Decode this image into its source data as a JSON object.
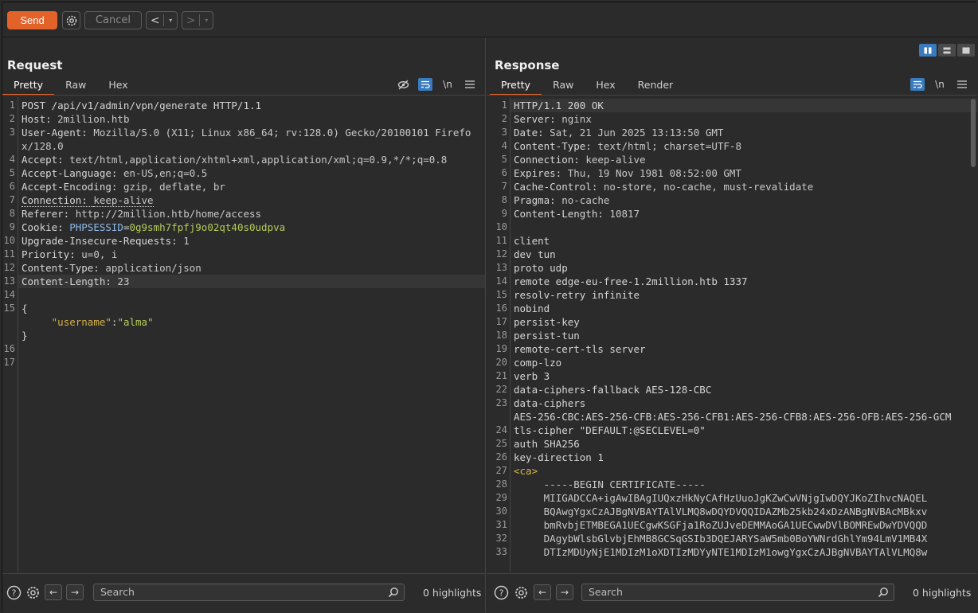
{
  "toolbar": {
    "send_label": "Send",
    "cancel_label": "Cancel",
    "back_glyph": "<",
    "forward_glyph": ">",
    "dropdown_glyph": "▾"
  },
  "request": {
    "title": "Request",
    "tabs": [
      "Pretty",
      "Raw",
      "Hex"
    ],
    "active_tab": "Pretty",
    "tools": [
      "eye-slash-icon",
      "wrap-icon",
      "newline-icon",
      "menu-icon"
    ],
    "newline_label": "\\n",
    "lines": [
      {
        "n": "1",
        "key": "POST /api/v1/admin/vpn/generate HTTP/1.1",
        "val": ""
      },
      {
        "n": "2",
        "key": "Host: ",
        "val": "2million.htb"
      },
      {
        "n": "3",
        "key": "User-Agent: ",
        "val": "Mozilla/5.0 (X11; Linux x86_64; rv:128.0) Gecko/20100101 Firefox/128.0"
      },
      {
        "n": "4",
        "key": "Accept: ",
        "val": "text/html,application/xhtml+xml,application/xml;q=0.9,*/*;q=0.8"
      },
      {
        "n": "5",
        "key": "Accept-Language: ",
        "val": "en-US,en;q=0.5"
      },
      {
        "n": "6",
        "key": "Accept-Encoding: ",
        "val": "gzip, deflate, br"
      },
      {
        "n": "7",
        "key": "Connection: ",
        "val": "keep-alive"
      },
      {
        "n": "8",
        "key": "Referer: ",
        "val": "http://2million.htb/home/access"
      },
      {
        "n": "9",
        "key": "Cookie: ",
        "cookie_key": "PHPSESSID",
        "cookie_val": "0g9smh7fpfj9o02qt40s0udpva"
      },
      {
        "n": "10",
        "key": "Upgrade-Insecure-Requests: ",
        "val": "1"
      },
      {
        "n": "11",
        "key": "Priority: ",
        "val": "u=0, i"
      },
      {
        "n": "12",
        "key": "Content-Type: ",
        "val": "application/json"
      },
      {
        "n": "13",
        "key": "Content-Length: ",
        "val": "23"
      },
      {
        "n": "14",
        "key": "",
        "val": ""
      },
      {
        "n": "15",
        "key": "{",
        "val": ""
      },
      {
        "n": "",
        "json_key": "\"username\"",
        "json_val": "\"alma\""
      },
      {
        "n": "",
        "key": "}",
        "val": ""
      },
      {
        "n": "16",
        "key": "",
        "val": ""
      },
      {
        "n": "17",
        "key": "",
        "val": ""
      }
    ],
    "search_placeholder": "Search",
    "highlights": "0 highlights"
  },
  "response": {
    "title": "Response",
    "tabs": [
      "Pretty",
      "Raw",
      "Hex",
      "Render"
    ],
    "active_tab": "Pretty",
    "tools": [
      "wrap-icon",
      "newline-icon",
      "menu-icon"
    ],
    "newline_label": "\\n",
    "lines": [
      {
        "n": "1",
        "key": "HTTP/1.1 200 OK",
        "val": ""
      },
      {
        "n": "2",
        "key": "Server: ",
        "val": "nginx"
      },
      {
        "n": "3",
        "key": "Date: ",
        "val": "Sat, 21 Jun 2025 13:13:50 GMT"
      },
      {
        "n": "4",
        "key": "Content-Type: ",
        "val": "text/html; charset=UTF-8"
      },
      {
        "n": "5",
        "key": "Connection: ",
        "val": "keep-alive"
      },
      {
        "n": "6",
        "key": "Expires: ",
        "val": "Thu, 19 Nov 1981 08:52:00 GMT"
      },
      {
        "n": "7",
        "key": "Cache-Control: ",
        "val": "no-store, no-cache, must-revalidate"
      },
      {
        "n": "8",
        "key": "Pragma: ",
        "val": "no-cache"
      },
      {
        "n": "9",
        "key": "Content-Length: ",
        "val": "10817"
      },
      {
        "n": "10",
        "key": "",
        "val": ""
      },
      {
        "n": "11",
        "key": "client",
        "val": ""
      },
      {
        "n": "12",
        "key": "dev tun",
        "val": ""
      },
      {
        "n": "13",
        "key": "proto udp",
        "val": ""
      },
      {
        "n": "14",
        "key": "remote edge-eu-free-1.2million.htb 1337",
        "val": ""
      },
      {
        "n": "15",
        "key": "resolv-retry infinite",
        "val": ""
      },
      {
        "n": "16",
        "key": "nobind",
        "val": ""
      },
      {
        "n": "17",
        "key": "persist-key",
        "val": ""
      },
      {
        "n": "18",
        "key": "persist-tun",
        "val": ""
      },
      {
        "n": "19",
        "key": "remote-cert-tls server",
        "val": ""
      },
      {
        "n": "20",
        "key": "comp-lzo",
        "val": ""
      },
      {
        "n": "21",
        "key": "verb 3",
        "val": ""
      },
      {
        "n": "22",
        "key": "data-ciphers-fallback AES-128-CBC",
        "val": ""
      },
      {
        "n": "23",
        "key": "data-ciphers",
        "val": ""
      },
      {
        "n": "",
        "key": "AES-256-CBC:AES-256-CFB:AES-256-CFB1:AES-256-CFB8:AES-256-OFB:AES-256-GCM",
        "val": ""
      },
      {
        "n": "24",
        "key": "tls-cipher \"DEFAULT:@SECLEVEL=0\"",
        "val": ""
      },
      {
        "n": "25",
        "key": "auth SHA256",
        "val": ""
      },
      {
        "n": "26",
        "key": "key-direction 1",
        "val": ""
      },
      {
        "n": "27",
        "tag": "<ca>"
      },
      {
        "n": "28",
        "indent": "-----BEGIN CERTIFICATE-----"
      },
      {
        "n": "29",
        "indent": "MIIGADCCA+igAwIBAgIUQxzHkNyCAfHzUuoJgKZwCwVNjgIwDQYJKoZIhvcNAQEL"
      },
      {
        "n": "30",
        "indent": "BQAwgYgxCzAJBgNVBAYTAlVLMQ8wDQYDVQQIDAZMb25kb24xDzANBgNVBAcMBkxv"
      },
      {
        "n": "31",
        "indent": "bmRvbjETMBEGA1UECgwKSGFja1RoZUJveDEMMAoGA1UECwwDVlBOMREwDwYDVQQD"
      },
      {
        "n": "32",
        "indent": "DAgybWlsbGlvbjEhMB8GCSqGSIb3DQEJARYSaW5mb0BoYWNrdGhlYm94LmV1MB4X"
      },
      {
        "n": "33",
        "indent": "DTIzMDUyNjE1MDIzM1oXDTIzMDYyNTE1MDIzM1owgYgxCzAJBgNVBAYTAlVLMQ8w"
      }
    ],
    "search_placeholder": "Search",
    "highlights": "0 highlights"
  },
  "colors": {
    "accent": "#e3622a",
    "toggle_active": "#3a7bbf"
  }
}
